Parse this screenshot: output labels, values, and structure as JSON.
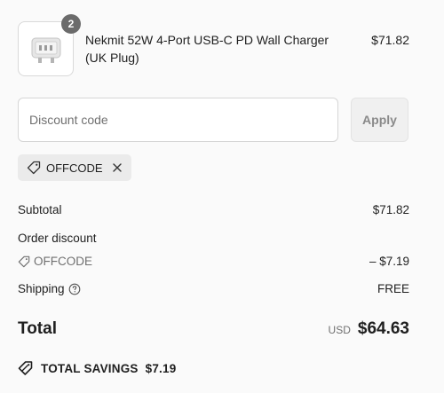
{
  "product": {
    "quantity": "2",
    "title": "Nekmit 52W 4-Port USB-C PD Wall Charger (UK Plug)",
    "price": "$71.82",
    "image_icon": "charger-product-image"
  },
  "discount": {
    "placeholder": "Discount code",
    "apply_label": "Apply",
    "applied_code": "OFFCODE"
  },
  "summary": {
    "subtotal_label": "Subtotal",
    "subtotal_value": "$71.82",
    "order_discount_label": "Order discount",
    "discount_code": "OFFCODE",
    "discount_value": "– $7.19",
    "shipping_label": "Shipping",
    "shipping_value": "FREE",
    "total_label": "Total",
    "currency": "USD",
    "total_value": "$64.63",
    "savings_label": "TOTAL SAVINGS",
    "savings_value": "$7.19"
  },
  "colors": {
    "background": "#fafafa",
    "badge": "#6b6b6b",
    "muted_text": "#707070",
    "chip_bg": "#ebebeb",
    "apply_bg": "#f0f0f0"
  }
}
